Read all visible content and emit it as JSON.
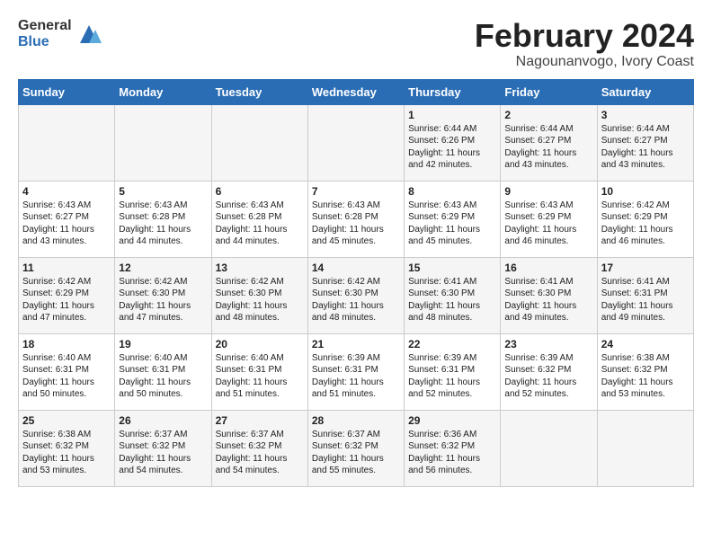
{
  "header": {
    "logo_general": "General",
    "logo_blue": "Blue",
    "title": "February 2024",
    "subtitle": "Nagounanvogo, Ivory Coast"
  },
  "weekdays": [
    "Sunday",
    "Monday",
    "Tuesday",
    "Wednesday",
    "Thursday",
    "Friday",
    "Saturday"
  ],
  "weeks": [
    [
      {
        "day": "",
        "info": ""
      },
      {
        "day": "",
        "info": ""
      },
      {
        "day": "",
        "info": ""
      },
      {
        "day": "",
        "info": ""
      },
      {
        "day": "1",
        "info": "Sunrise: 6:44 AM\nSunset: 6:26 PM\nDaylight: 11 hours\nand 42 minutes."
      },
      {
        "day": "2",
        "info": "Sunrise: 6:44 AM\nSunset: 6:27 PM\nDaylight: 11 hours\nand 43 minutes."
      },
      {
        "day": "3",
        "info": "Sunrise: 6:44 AM\nSunset: 6:27 PM\nDaylight: 11 hours\nand 43 minutes."
      }
    ],
    [
      {
        "day": "4",
        "info": "Sunrise: 6:43 AM\nSunset: 6:27 PM\nDaylight: 11 hours\nand 43 minutes."
      },
      {
        "day": "5",
        "info": "Sunrise: 6:43 AM\nSunset: 6:28 PM\nDaylight: 11 hours\nand 44 minutes."
      },
      {
        "day": "6",
        "info": "Sunrise: 6:43 AM\nSunset: 6:28 PM\nDaylight: 11 hours\nand 44 minutes."
      },
      {
        "day": "7",
        "info": "Sunrise: 6:43 AM\nSunset: 6:28 PM\nDaylight: 11 hours\nand 45 minutes."
      },
      {
        "day": "8",
        "info": "Sunrise: 6:43 AM\nSunset: 6:29 PM\nDaylight: 11 hours\nand 45 minutes."
      },
      {
        "day": "9",
        "info": "Sunrise: 6:43 AM\nSunset: 6:29 PM\nDaylight: 11 hours\nand 46 minutes."
      },
      {
        "day": "10",
        "info": "Sunrise: 6:42 AM\nSunset: 6:29 PM\nDaylight: 11 hours\nand 46 minutes."
      }
    ],
    [
      {
        "day": "11",
        "info": "Sunrise: 6:42 AM\nSunset: 6:29 PM\nDaylight: 11 hours\nand 47 minutes."
      },
      {
        "day": "12",
        "info": "Sunrise: 6:42 AM\nSunset: 6:30 PM\nDaylight: 11 hours\nand 47 minutes."
      },
      {
        "day": "13",
        "info": "Sunrise: 6:42 AM\nSunset: 6:30 PM\nDaylight: 11 hours\nand 48 minutes."
      },
      {
        "day": "14",
        "info": "Sunrise: 6:42 AM\nSunset: 6:30 PM\nDaylight: 11 hours\nand 48 minutes."
      },
      {
        "day": "15",
        "info": "Sunrise: 6:41 AM\nSunset: 6:30 PM\nDaylight: 11 hours\nand 48 minutes."
      },
      {
        "day": "16",
        "info": "Sunrise: 6:41 AM\nSunset: 6:30 PM\nDaylight: 11 hours\nand 49 minutes."
      },
      {
        "day": "17",
        "info": "Sunrise: 6:41 AM\nSunset: 6:31 PM\nDaylight: 11 hours\nand 49 minutes."
      }
    ],
    [
      {
        "day": "18",
        "info": "Sunrise: 6:40 AM\nSunset: 6:31 PM\nDaylight: 11 hours\nand 50 minutes."
      },
      {
        "day": "19",
        "info": "Sunrise: 6:40 AM\nSunset: 6:31 PM\nDaylight: 11 hours\nand 50 minutes."
      },
      {
        "day": "20",
        "info": "Sunrise: 6:40 AM\nSunset: 6:31 PM\nDaylight: 11 hours\nand 51 minutes."
      },
      {
        "day": "21",
        "info": "Sunrise: 6:39 AM\nSunset: 6:31 PM\nDaylight: 11 hours\nand 51 minutes."
      },
      {
        "day": "22",
        "info": "Sunrise: 6:39 AM\nSunset: 6:31 PM\nDaylight: 11 hours\nand 52 minutes."
      },
      {
        "day": "23",
        "info": "Sunrise: 6:39 AM\nSunset: 6:32 PM\nDaylight: 11 hours\nand 52 minutes."
      },
      {
        "day": "24",
        "info": "Sunrise: 6:38 AM\nSunset: 6:32 PM\nDaylight: 11 hours\nand 53 minutes."
      }
    ],
    [
      {
        "day": "25",
        "info": "Sunrise: 6:38 AM\nSunset: 6:32 PM\nDaylight: 11 hours\nand 53 minutes."
      },
      {
        "day": "26",
        "info": "Sunrise: 6:37 AM\nSunset: 6:32 PM\nDaylight: 11 hours\nand 54 minutes."
      },
      {
        "day": "27",
        "info": "Sunrise: 6:37 AM\nSunset: 6:32 PM\nDaylight: 11 hours\nand 54 minutes."
      },
      {
        "day": "28",
        "info": "Sunrise: 6:37 AM\nSunset: 6:32 PM\nDaylight: 11 hours\nand 55 minutes."
      },
      {
        "day": "29",
        "info": "Sunrise: 6:36 AM\nSunset: 6:32 PM\nDaylight: 11 hours\nand 56 minutes."
      },
      {
        "day": "",
        "info": ""
      },
      {
        "day": "",
        "info": ""
      }
    ]
  ]
}
